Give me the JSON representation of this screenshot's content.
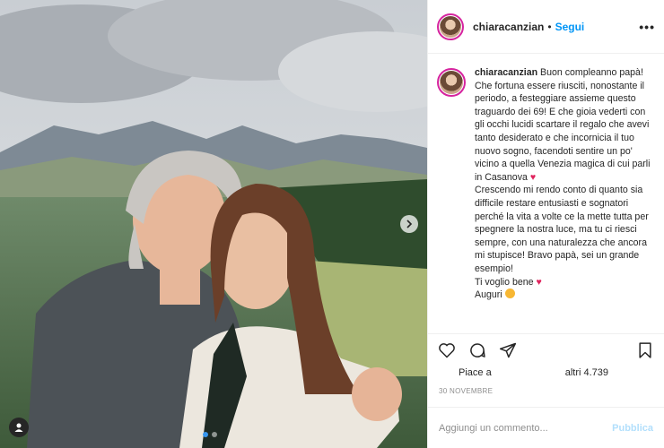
{
  "post": {
    "username": "chiaracanzian",
    "follow_label": "Segui",
    "separator": "•",
    "more": "•••"
  },
  "caption": {
    "username": "chiaracanzian",
    "text_1": "Buon compleanno papà! Che fortuna essere riusciti, nonostante il periodo, a festeggiare assieme questo traguardo dei 69! E che gioia vederti con gli occhi lucidi scartare il regalo che avevi tanto desiderato e che incornicia il tuo nuovo sogno, facendoti sentire un po' vicino a quella Venezia magica di cui parli in Casanova",
    "text_2": "Crescendo mi rendo conto di quanto sia difficile restare entusiasti e sognatori perché la vita a volte ce la mette tutta per spegnere la nostra luce, ma tu ci riesci sempre, con una naturalezza che ancora mi stupisce! Bravo papà, sei un grande esempio!",
    "text_3": "Ti voglio bene",
    "text_4": "Auguri",
    "heart": "♥"
  },
  "likes": {
    "prefix": "Piace a",
    "suffix": "altri 4.739"
  },
  "date": "30 NOVEMBRE",
  "comment_box": {
    "placeholder": "Aggiungi un commento...",
    "publish_label": "Pubblica"
  },
  "icons": {
    "like": "heart-icon",
    "comment": "comment-icon",
    "share": "share-icon",
    "save": "bookmark-icon",
    "next": "chevron-right-icon",
    "tag": "user-tag-icon"
  },
  "colors": {
    "follow": "#0095f6",
    "story_ring": "#d6249f",
    "heart": "#e0245e",
    "publish_disabled": "#b2dffc"
  }
}
